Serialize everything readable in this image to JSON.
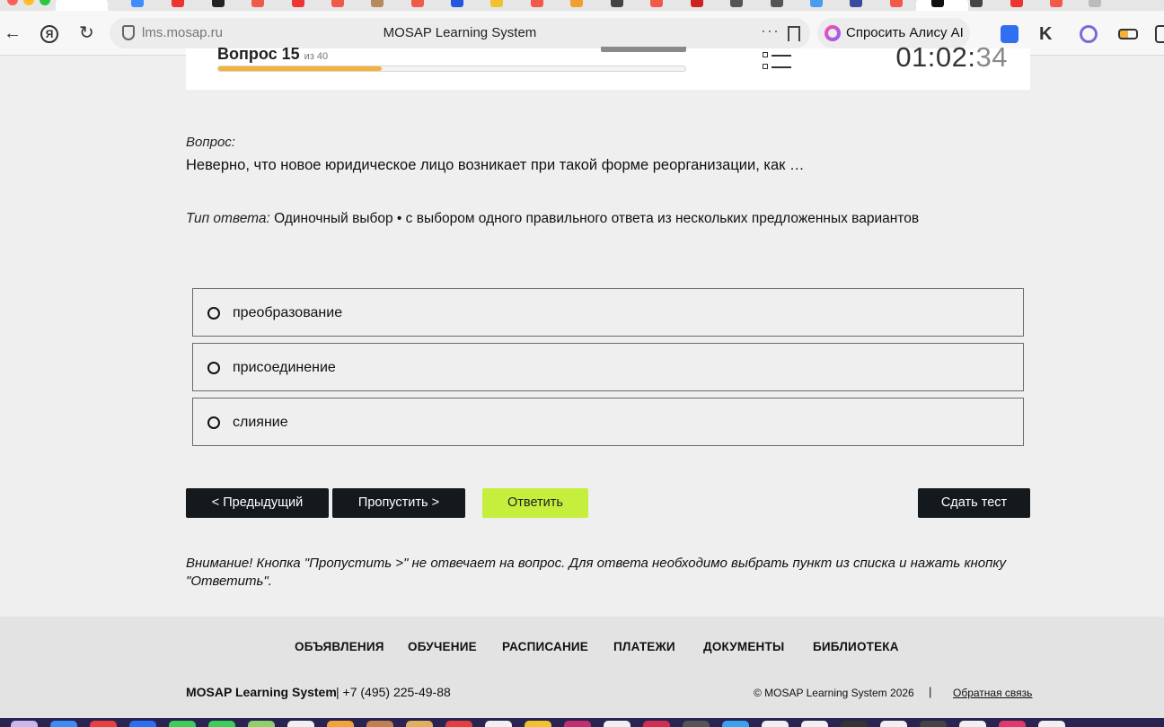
{
  "browser": {
    "url": "lms.mosap.ru",
    "page_title": "MOSAP Learning System",
    "menu_dots": "···",
    "alice_button": "Спросить Алису AI"
  },
  "header": {
    "question_counter": "Вопрос 15",
    "question_total": "из 40",
    "progress_percent": 35,
    "timer_main": "01:02:",
    "timer_seconds": "34"
  },
  "question": {
    "label": "Вопрос:",
    "text": "Неверно, что новое юридическое лицо возникает при такой форме реорганизации, как …",
    "answer_type_label": "Тип ответа:",
    "answer_type_value": " Одиночный выбор • с выбором одного правильного ответа из нескольких предложенных вариантов"
  },
  "options": [
    "преобразование",
    "присоединение",
    "слияние"
  ],
  "buttons": {
    "prev": "< Предыдущий",
    "skip": "Пропустить >",
    "answer": "Ответить",
    "submit": "Сдать тест"
  },
  "warning": "Внимание! Кнопка \"Пропустить >\" не отвечает на вопрос. Для ответа необходимо выбрать пункт из списка и нажать кнопку \"Ответить\".",
  "footer": {
    "nav": [
      "ОБЪЯВЛЕНИЯ",
      "ОБУЧЕНИЕ",
      "РАСПИСАНИЕ",
      "ПЛАТЕЖИ",
      "ДОКУМЕНТЫ",
      "БИБЛИОТЕКА"
    ],
    "brand": "MOSAP Learning System",
    "phone": "| +7 (495) 225-49-88",
    "copyright": "© MOSAP Learning System 2026",
    "separator": "|",
    "feedback": "Обратная связь"
  },
  "colors": {
    "accent_green": "#c6ef3d",
    "progress_orange": "#f4b13c",
    "button_dark": "#14191e"
  }
}
